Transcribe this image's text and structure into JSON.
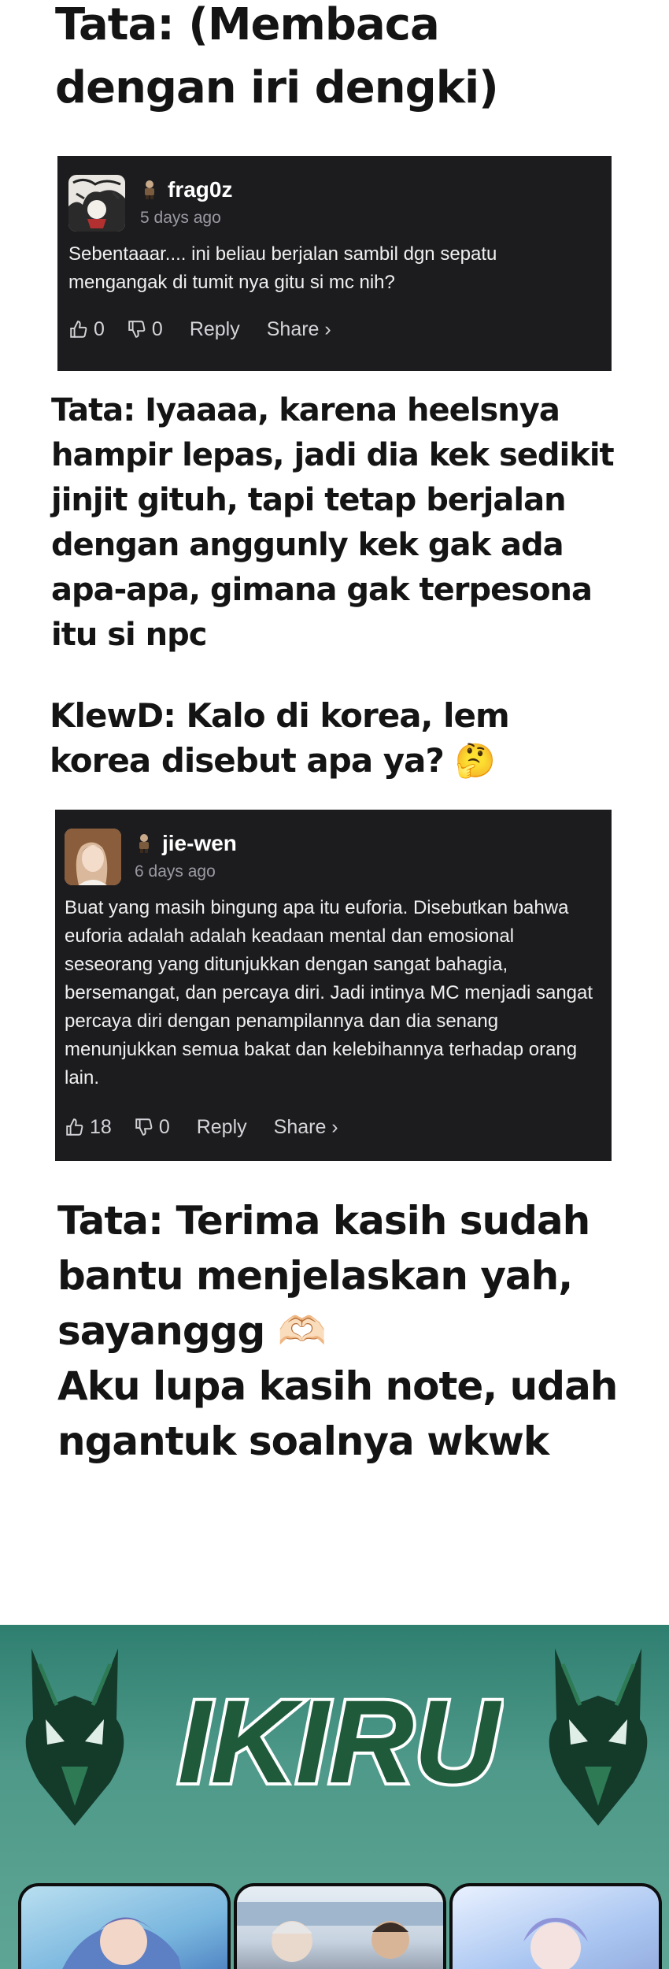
{
  "notes": {
    "tata_intro": "Tata: (Membaca dengan iri dengki)",
    "tata_reply": "Tata: Iyaaaa, karena heelsnya hampir lepas, jadi dia kek sedikit jinjit gituh, tapi tetap berjalan dengan anggunly kek gak ada apa-apa, gimana gak terpesona itu si npc",
    "klewd_question": "KlewD: Kalo di korea, lem korea disebut apa ya? 🤔",
    "tata_thanks_line1": "Tata: Terima kasih sudah bantu menjelaskan yah, sayanggg 🫶🏻",
    "tata_thanks_line2": "Aku lupa kasih note, udah ngantuk soalnya wkwk"
  },
  "comments": [
    {
      "username": "frag0z",
      "time": "5 days ago",
      "text": "Sebentaaar.... ini beliau berjalan sambil dgn sepatu mengangak di tumit nya gitu si mc nih?",
      "likes": "0",
      "dislikes": "0",
      "reply_label": "Reply",
      "share_label": "Share ›",
      "avatar_icon": "avatar-manga-icon",
      "badge_icon": "rank-badge-icon"
    },
    {
      "username": "jie-wen",
      "time": "6 days ago",
      "text": "Buat yang masih bingung apa itu euforia. Disebutkan bahwa euforia adalah adalah keadaan mental dan emosional seseorang yang ditunjukkan dengan sangat bahagia, bersemangat, dan percaya diri. Jadi intinya MC menjadi sangat percaya diri dengan penampilannya dan dia senang menunjukkan semua bakat dan kelebihannya terhadap orang lain.",
      "likes": "18",
      "dislikes": "0",
      "reply_label": "Reply",
      "share_label": "Share ›",
      "avatar_icon": "avatar-photo-icon",
      "badge_icon": "rank-badge-icon"
    }
  ],
  "banner": {
    "logo_text": "IKIRU",
    "left_icon": "jackal-mask-icon",
    "right_icon": "jackal-mask-icon",
    "thumbnails": [
      "manga-cover-1",
      "manga-cover-2",
      "manga-cover-3"
    ]
  },
  "colors": {
    "card_bg": "#1c1c1f",
    "banner_green": "#4e9989",
    "logo_green": "#1f5a3a"
  }
}
